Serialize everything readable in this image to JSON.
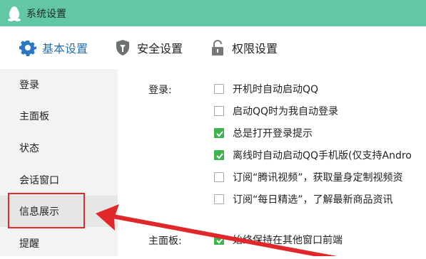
{
  "window": {
    "title": "系统设置"
  },
  "tabs": [
    {
      "label": "基本设置",
      "icon": "gear-icon",
      "active": true
    },
    {
      "label": "安全设置",
      "icon": "shield-icon",
      "active": false
    },
    {
      "label": "权限设置",
      "icon": "lock-icon",
      "active": false
    }
  ],
  "sidebar": {
    "items": [
      {
        "label": "登录"
      },
      {
        "label": "主面板"
      },
      {
        "label": "状态"
      },
      {
        "label": "会话窗口"
      },
      {
        "label": "信息展示"
      },
      {
        "label": "提醒"
      }
    ]
  },
  "login_section": {
    "label": "登录:",
    "options": [
      {
        "label": "开机时自动启动QQ",
        "checked": false
      },
      {
        "label": "启动QQ时为我自动登录",
        "checked": false
      },
      {
        "label": "总是打开登录提示",
        "checked": true
      },
      {
        "label": "离线时自动启动QQ手机版(仅支持Andro",
        "checked": true
      },
      {
        "label": "订阅“腾讯视频”，获取量身定制视频资",
        "checked": false
      },
      {
        "label": "订阅“每日精选”，了解最新商品资讯",
        "checked": false
      }
    ]
  },
  "main_panel_section": {
    "label": "主面板:",
    "options": [
      {
        "label": "始终保持在其他窗口前端",
        "checked": true
      }
    ]
  },
  "colors": {
    "titlebar": "#61c7a4",
    "accent": "#2a6fa8",
    "check": "#3eb34f",
    "annotation": "#e0282b"
  }
}
